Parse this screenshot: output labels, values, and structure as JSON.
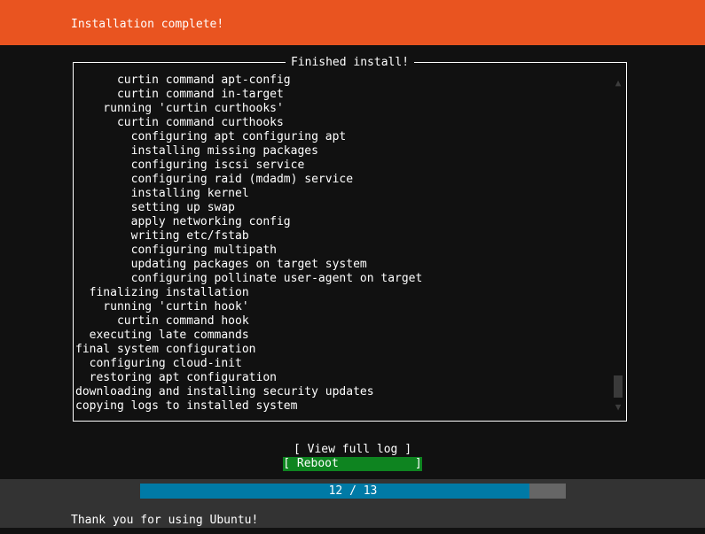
{
  "header": {
    "title": "Installation complete!",
    "background_color": "#e95420"
  },
  "log_panel": {
    "title": "Finished install!",
    "lines": [
      "      curtin command apt-config",
      "      curtin command in-target",
      "    running 'curtin curthooks'",
      "      curtin command curthooks",
      "        configuring apt configuring apt",
      "        installing missing packages",
      "        configuring iscsi service",
      "        configuring raid (mdadm) service",
      "        installing kernel",
      "        setting up swap",
      "        apply networking config",
      "        writing etc/fstab",
      "        configuring multipath",
      "        updating packages on target system",
      "        configuring pollinate user-agent on target",
      "  finalizing installation",
      "    running 'curtin hook'",
      "      curtin command hook",
      "  executing late commands",
      "final system configuration",
      "  configuring cloud-init",
      "  restoring apt configuration",
      "downloading and installing security updates",
      "copying logs to installed system"
    ],
    "scrollbar": {
      "up_arrow": "▲",
      "down_arrow": "▼"
    }
  },
  "buttons": {
    "view_full_log": "[ View full log ]",
    "reboot": "[ Reboot           ]",
    "selected_color": "#0e8420"
  },
  "progress": {
    "label": "12 / 13",
    "current": 12,
    "total": 13,
    "percent": 91.4,
    "fill_color": "#007aa6",
    "track_color": "#666666"
  },
  "footer": {
    "text": "Thank you for using Ubuntu!",
    "background_color": "#333333"
  }
}
